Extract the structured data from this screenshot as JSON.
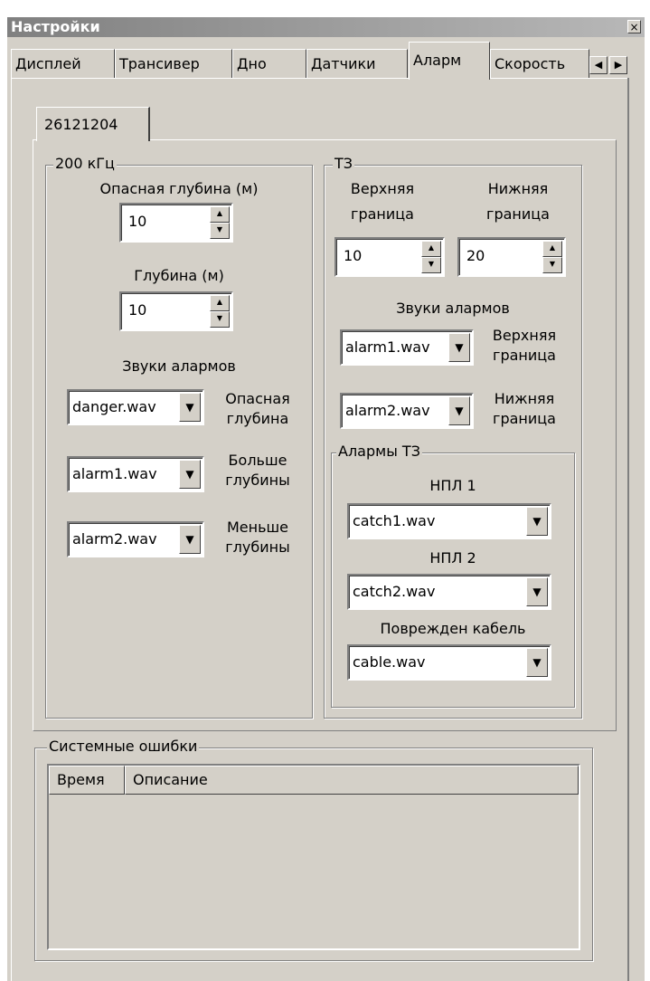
{
  "window": {
    "title": "Настройки",
    "close_glyph": "×"
  },
  "tabs": [
    {
      "label": "Дисплей"
    },
    {
      "label": "Трансивер"
    },
    {
      "label": "Дно"
    },
    {
      "label": "Датчики"
    },
    {
      "label": "Аларм"
    },
    {
      "label": "Скорость"
    }
  ],
  "tab_scroll": {
    "left": "◀",
    "right": "▶"
  },
  "inner_tab": {
    "label": "26121204"
  },
  "freq_group": {
    "label": "200 кГц",
    "danger_depth": {
      "label": "Опасная глубина (м)",
      "value": "10"
    },
    "depth": {
      "label": "Глубина (м)",
      "value": "10"
    },
    "sounds_label": "Звуки алармов",
    "sounds": [
      {
        "value": "danger.wav",
        "label_line1": "Опасная",
        "label_line2": "глубина"
      },
      {
        "value": "alarm1.wav",
        "label_line1": "Больше",
        "label_line2": "глубины"
      },
      {
        "value": "alarm2.wav",
        "label_line1": "Меньше",
        "label_line2": "глубины"
      }
    ]
  },
  "tz_group": {
    "label": "ТЗ",
    "upper": {
      "line1": "Верхняя",
      "line2": "граница",
      "value": "10"
    },
    "lower": {
      "line1": "Нижняя",
      "line2": "граница",
      "value": "20"
    },
    "sounds_label": "Звуки алармов",
    "sounds": [
      {
        "value": "alarm1.wav",
        "label_line1": "Верхняя",
        "label_line2": "граница"
      },
      {
        "value": "alarm2.wav",
        "label_line1": "Нижняя",
        "label_line2": "граница"
      }
    ],
    "alarms_group": {
      "label": "Алармы ТЗ",
      "items": [
        {
          "label": "НПЛ 1",
          "value": "catch1.wav"
        },
        {
          "label": "НПЛ 2",
          "value": "catch2.wav"
        },
        {
          "label": "Поврежден кабель",
          "value": "cable.wav"
        }
      ]
    }
  },
  "system_errors": {
    "label": "Системные ошибки",
    "columns": [
      "Время",
      "Описание"
    ]
  },
  "icons": {
    "spin_up": "▲",
    "spin_down": "▼",
    "dropdown": "▼"
  }
}
